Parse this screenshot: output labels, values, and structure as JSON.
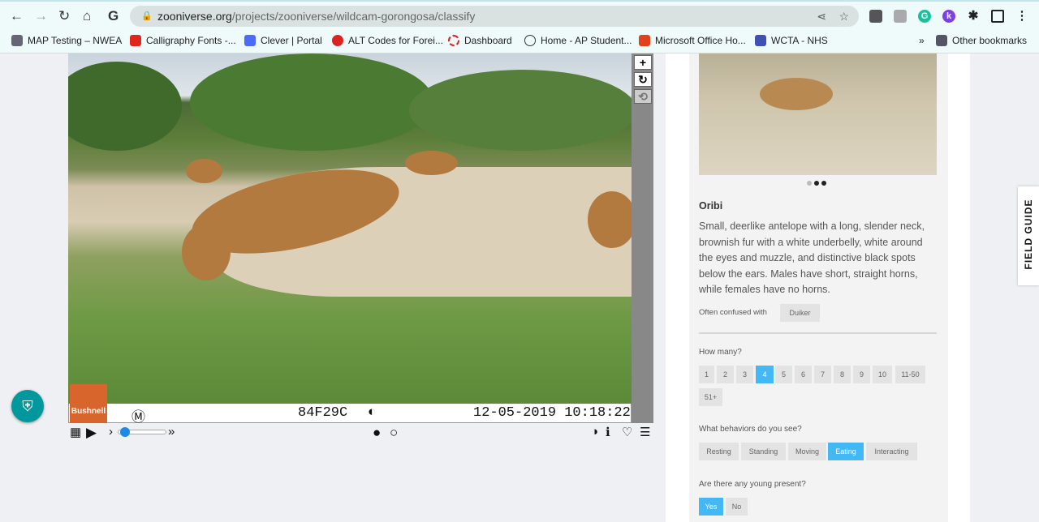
{
  "browser": {
    "url_host": "zooniverse.org",
    "url_path": "/projects/zooniverse/wildcam-gorongosa/classify",
    "bookmarks": [
      "MAP Testing – NWEA",
      "Calligraphy Fonts -...",
      "Clever | Portal",
      "ALT Codes for Forei...",
      "Dashboard",
      "Home - AP Student...",
      "Microsoft Office Ho...",
      "WCTA - NHS"
    ],
    "other_bookmarks": "Other bookmarks"
  },
  "camera": {
    "brand": "Bushnell",
    "moon": "Ⓜ",
    "id": "84F29C",
    "datetime": "12-05-2019 10:18:22"
  },
  "field_guide": {
    "label": "FIELD GUIDE"
  },
  "species": {
    "name": "Oribi",
    "description": "Small, deerlike antelope with a long, slender neck, brownish fur with a white underbelly, white around the eyes and muzzle, and distinctive black spots below the ears. Males have short, straight horns, while females have no horns.",
    "confused_label": "Often confused with",
    "confused_with": "Duiker"
  },
  "questions": {
    "how_many": {
      "label": "How many?",
      "options": [
        "1",
        "2",
        "3",
        "4",
        "5",
        "6",
        "7",
        "8",
        "9",
        "10",
        "11-50",
        "51+"
      ],
      "selected": "4"
    },
    "behaviors": {
      "label": "What behaviors do you see?",
      "options": [
        "Resting",
        "Standing",
        "Moving",
        "Eating",
        "Interacting"
      ],
      "selected": "Eating"
    },
    "young": {
      "label": "Are there any young present?",
      "options": [
        "Yes",
        "No"
      ],
      "selected": "Yes"
    }
  },
  "colors": {
    "accent": "#44b8f5",
    "help": "#00979d"
  }
}
